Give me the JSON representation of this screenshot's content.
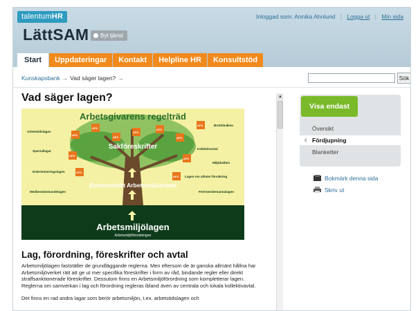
{
  "brand": {
    "name": "talentum",
    "suffix": "HR"
  },
  "user_bar": {
    "logged_in_text": "Inloggad som: Annika Ahnlund",
    "logout_label": "Logga ut",
    "my_page_label": "Min sida"
  },
  "app": {
    "title": "LättSAM",
    "switch_service_label": "Byt tjänst"
  },
  "nav": {
    "tabs": [
      {
        "label": "Start",
        "active": true
      },
      {
        "label": "Uppdateringar",
        "active": false
      },
      {
        "label": "Kontakt",
        "active": false
      },
      {
        "label": "Helpline HR",
        "active": false
      },
      {
        "label": "Konsultstöd",
        "active": false
      }
    ]
  },
  "breadcrumb": {
    "items": [
      "Kunskapsbank",
      "Vad säger lagen?"
    ]
  },
  "search": {
    "button_label": "Sök",
    "placeholder": ""
  },
  "page": {
    "title": "Vad säger lagen?",
    "section_title": "Lag, förordning, föreskrifter och avtal",
    "para1": "Arbetsmiljölagen fastställer de grundläggande reglerna. Men eftersom de är ganska allmänt hållna har Arbetsmiljöverket rätt att ge ut mer specifika föreskrifter i form av råd, bindande regler eller direkt straffsanktionerade föreskrifter. Dessutom finns en Arbetsmiljöförordning som kompletterar lagen. Reglerna om samverkan i lag och förordning regleras ibland även av centrala och lokala kollektivavtal.",
    "para2": "Det finns en rad andra lagar som berör arbetsmiljön, t.ex. arbetstidslagen och"
  },
  "diagram": {
    "title": "Arbetsgivarens regelträd",
    "crown_label": "Sakföreskrifter",
    "trunk_label": "Systematiskt Arbetsmiljöarbete",
    "root_label": "Arbetsmiljölagen",
    "root_sub": "Arbetsmiljöförordningen",
    "afs_label": "AFS",
    "left_labels": [
      "Arbetstidslagen",
      "Speciallagar",
      "Diskrimineringslagen",
      "Medbestämmandelagen"
    ],
    "right_labels": [
      "Brottsbalken",
      "Kollektivavtal",
      "Miljöbalken",
      "Lagen om allmän försäkring",
      "Förtroendemannalagen"
    ],
    "colors": {
      "sky": "#f4f1a4",
      "ground": "#0e3c1b",
      "leaf": "#3f9a2c",
      "afs": "#e9761c",
      "trunk": "#6b4a2b"
    }
  },
  "sidebar": {
    "filter_title": "Visa endast",
    "items": [
      {
        "label": "Översikt",
        "active": false
      },
      {
        "label": "Fördjupning",
        "active": true
      },
      {
        "label": "Blanketter",
        "active": false
      }
    ],
    "bookmark_label": "Bokmärk denna sida",
    "print_label": "Skriv ut"
  },
  "colors": {
    "accent_orange": "#f08a1c",
    "accent_green": "#7ab92a",
    "header_blue": "#c8dbe6",
    "link_blue": "#2d6f96"
  }
}
